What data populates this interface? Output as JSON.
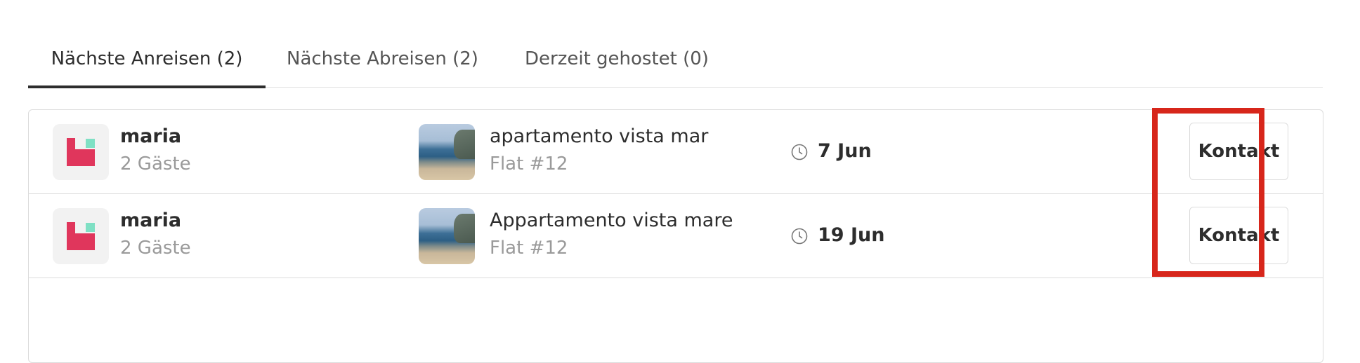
{
  "tabs": [
    {
      "label": "Nächste Anreisen (2)",
      "active": true
    },
    {
      "label": "Nächste Abreisen (2)",
      "active": false
    },
    {
      "label": "Derzeit gehostet (0)",
      "active": false
    }
  ],
  "reservations": [
    {
      "guest_name": "maria",
      "guest_count": "2 Gäste",
      "listing_title": "apartamento vista mar",
      "listing_unit": "Flat #12",
      "date": "7 Jun",
      "contact_label": "Kontakt"
    },
    {
      "guest_name": "maria",
      "guest_count": "2 Gäste",
      "listing_title": "Appartamento vista mare",
      "listing_unit": "Flat #12",
      "date": "19 Jun",
      "contact_label": "Kontakt"
    }
  ],
  "icons": {
    "avatar": "brand-logo-icon",
    "clock": "clock-icon"
  },
  "colors": {
    "brand_red": "#e0365c",
    "brand_green": "#7fe0c4",
    "highlight": "#d7261b",
    "muted_text": "#9a9a9a"
  }
}
